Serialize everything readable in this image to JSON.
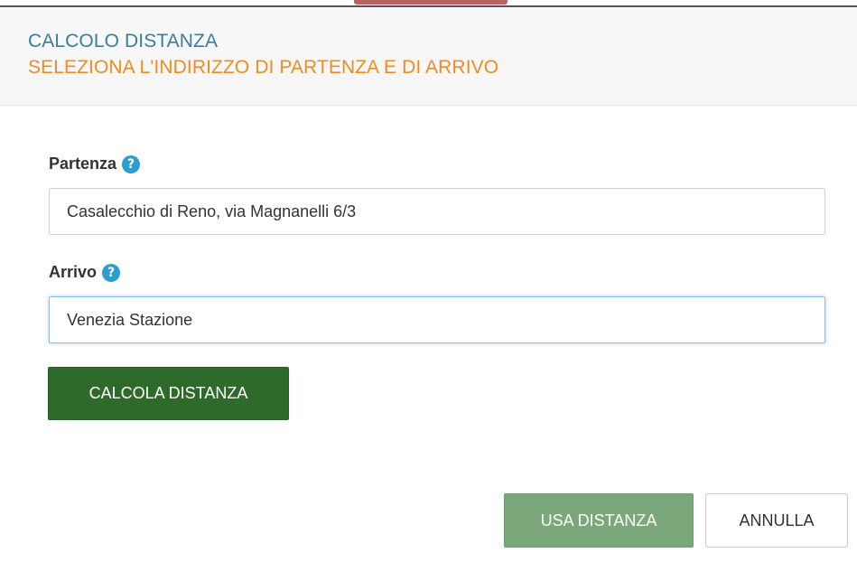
{
  "header": {
    "title": "CALCOLO DISTANZA",
    "subtitle": "SELEZIONA L'INDIRIZZO DI PARTENZA E DI ARRIVO"
  },
  "form": {
    "departure": {
      "label": "Partenza",
      "help_icon": "?",
      "value": "Casalecchio di Reno, via Magnanelli 6/3"
    },
    "arrival": {
      "label": "Arrivo",
      "help_icon": "?",
      "value": "Venezia Stazione"
    },
    "calculate_label": "CALCOLA DISTANZA"
  },
  "footer": {
    "use_distance_label": "USA DISTANZA",
    "cancel_label": "ANNULLA"
  },
  "colors": {
    "title": "#3a7d9c",
    "subtitle": "#ef8c1e",
    "help_icon": "#2b9fd0",
    "primary_button": "#2e6b2b",
    "use_button": "#7aa87a"
  }
}
